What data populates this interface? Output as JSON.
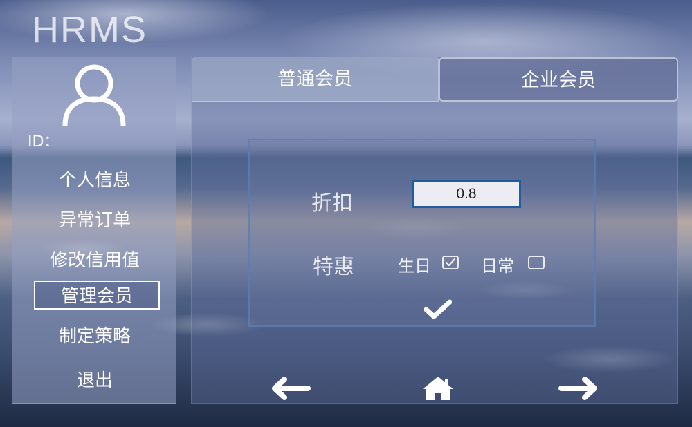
{
  "app": {
    "title": "HRMS"
  },
  "sidebar": {
    "id_label": "ID：",
    "items": [
      {
        "label": "个人信息"
      },
      {
        "label": "异常订单"
      },
      {
        "label": "修改信用值"
      },
      {
        "label": "管理会员",
        "active": true
      },
      {
        "label": "制定策略"
      },
      {
        "label": "退出"
      }
    ]
  },
  "tabs": [
    {
      "label": "普通会员",
      "selected": true
    },
    {
      "label": "企业会员",
      "selected": false
    }
  ],
  "form": {
    "discount_label": "折扣",
    "discount_value": "0.8",
    "benefit_label": "特惠",
    "options": [
      {
        "label": "生日",
        "checked": true
      },
      {
        "label": "日常",
        "checked": false
      }
    ]
  },
  "icons": {
    "avatar": "user-icon",
    "confirm": "checkmark-icon",
    "back": "arrow-left-icon",
    "home": "home-icon",
    "forward": "arrow-right-icon"
  },
  "colors": {
    "input_border": "#1f5d9e",
    "form_border": "#5a7db4"
  }
}
